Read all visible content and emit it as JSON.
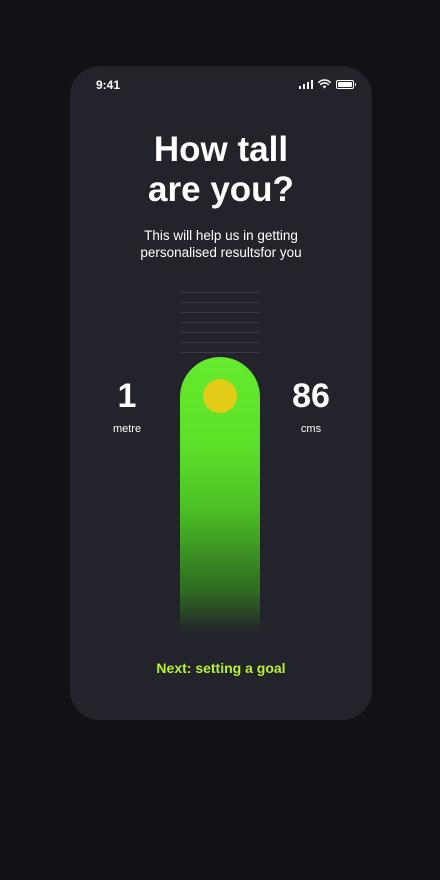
{
  "status_bar": {
    "time": "9:41",
    "icons": [
      "signal-icon",
      "wifi-icon",
      "battery-icon"
    ]
  },
  "header": {
    "title_line1": "How tall",
    "title_line2": "are you?",
    "subtitle_line1": "This will help us in getting",
    "subtitle_line2": "personalised resultsfor you"
  },
  "height_picker": {
    "metre_value": "1",
    "metre_unit": "metre",
    "cms_value": "86",
    "cms_unit": "cms"
  },
  "footer": {
    "next_label": "Next: setting a goal"
  },
  "colors": {
    "background": "#121216",
    "card": "#23232b",
    "gauge_green": "#66ea2e",
    "knob_yellow": "#e2cc18",
    "accent_text": "#b6f22e"
  }
}
